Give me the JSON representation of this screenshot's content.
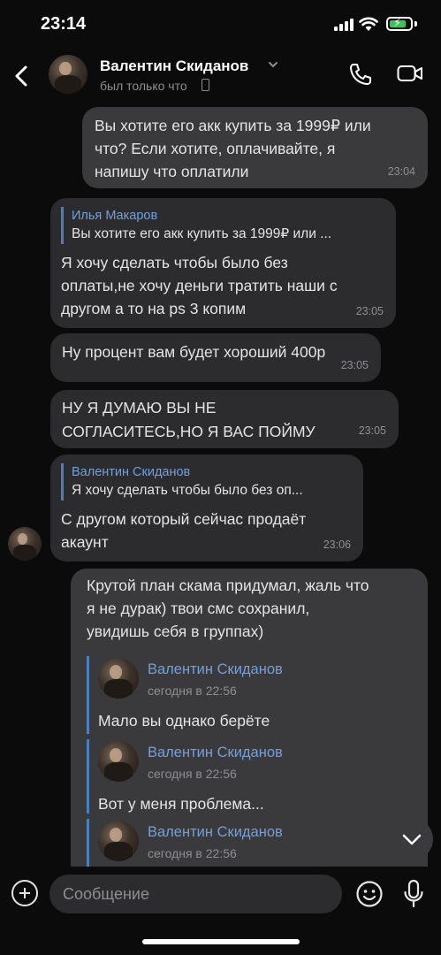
{
  "status_bar": {
    "time": "23:14"
  },
  "header": {
    "contact_name": "Валентин Скиданов",
    "presence": "был только что"
  },
  "messages": [
    {
      "text_lines": [
        "Вы хотите его акк купить за 1999₽ или",
        "что? Если хотите, оплачивайте, я",
        "напишу что оплатили"
      ],
      "time": "23:04"
    },
    {
      "reply_author": "Илья Макаров",
      "reply_text": "Вы хотите его акк купить за 1999₽ или ...",
      "text_lines": [
        "Я хочу сделать чтобы было без",
        "оплаты,не хочу деньги тратить наши с",
        "другом а то на ps 3 копим"
      ],
      "time": "23:05"
    },
    {
      "text": "Ну процент вам будет хороший 400р",
      "time": "23:05"
    },
    {
      "text_lines": [
        "НУ Я ДУМАЮ ВЫ НЕ",
        "СОГЛАСИТЕСЬ,НО Я ВАС ПОЙМУ"
      ],
      "time": "23:05"
    },
    {
      "reply_author": "Валентин Скиданов",
      "reply_text": "Я хочу сделать чтобы было без оп...",
      "text_lines": [
        "С другом который сейчас продаёт",
        "акаунт"
      ],
      "time": "23:06"
    },
    {
      "text_lines": [
        "Крутой план скама придумал, жаль что",
        "я не дурак) твои смс сохранил,",
        "увидишь себя в группах)"
      ],
      "forwards": [
        {
          "author": "Валентин Скиданов",
          "date": "сегодня в 22:56",
          "text": "Мало вы однако берёте"
        },
        {
          "author": "Валентин Скиданов",
          "date": "сегодня в 22:56",
          "text": "Вот у меня проблема..."
        },
        {
          "author": "Валентин Скиданов",
          "date": "сегодня в 22:56"
        }
      ]
    }
  ],
  "composer": {
    "placeholder": "Сообщение"
  },
  "colors": {
    "background": "#0b0b0b",
    "incoming_bubble": "#2c2c2e",
    "outgoing_bubble": "#3a3a3c",
    "accent": "#6fa0e0"
  }
}
